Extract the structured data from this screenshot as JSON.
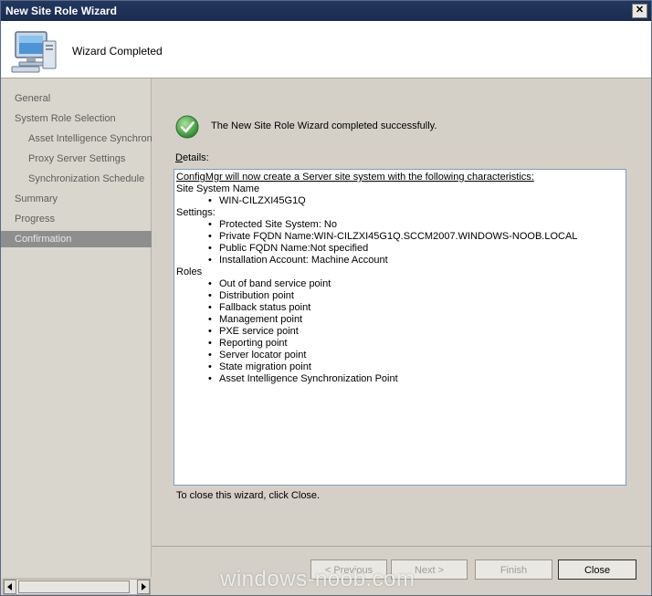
{
  "window": {
    "title": "New Site Role Wizard",
    "close_glyph": "✕"
  },
  "header": {
    "title": "Wizard Completed",
    "icon": "computer-icon"
  },
  "sidebar": {
    "items": [
      {
        "label": "General",
        "selected": false
      },
      {
        "label": "System Role Selection",
        "selected": false
      },
      {
        "label": "Asset Intelligence Synchron",
        "selected": false
      },
      {
        "label": "Proxy Server Settings",
        "selected": false
      },
      {
        "label": "Synchronization Schedule",
        "selected": false
      },
      {
        "label": "Summary",
        "selected": false
      },
      {
        "label": "Progress",
        "selected": false
      },
      {
        "label": "Confirmation",
        "selected": true
      }
    ]
  },
  "main": {
    "status_icon": "check-circle-icon",
    "status_color": "#3c9a3c",
    "status_text": "The New Site Role Wizard completed successfully.",
    "details_label_first": "D",
    "details_label_rest": "etails:",
    "details": {
      "intro": "ConfigMgr will now create a Server site system with the following characteristics:",
      "site_system_heading": "Site System Name",
      "site_system_name": "WIN-CILZXI45G1Q",
      "settings_heading": "Settings:",
      "settings": [
        "Protected Site System: No",
        "Private FQDN Name:WIN-CILZXI45G1Q.SCCM2007.WINDOWS-NOOB.LOCAL",
        "Public FQDN Name:Not specified",
        "Installation Account: Machine Account"
      ],
      "roles_heading": "Roles",
      "roles": [
        "Out of band service point",
        "Distribution point",
        "Fallback status point",
        "Management point",
        "PXE service point",
        "Reporting point",
        "Server locator point",
        "State migration point",
        "Asset Intelligence Synchronization Point"
      ]
    },
    "close_hint": "To close this wizard, click Close."
  },
  "buttons": {
    "previous": "< Previous",
    "next": "Next >",
    "finish": "Finish",
    "close": "Close"
  },
  "watermark": "windows-noob.com"
}
